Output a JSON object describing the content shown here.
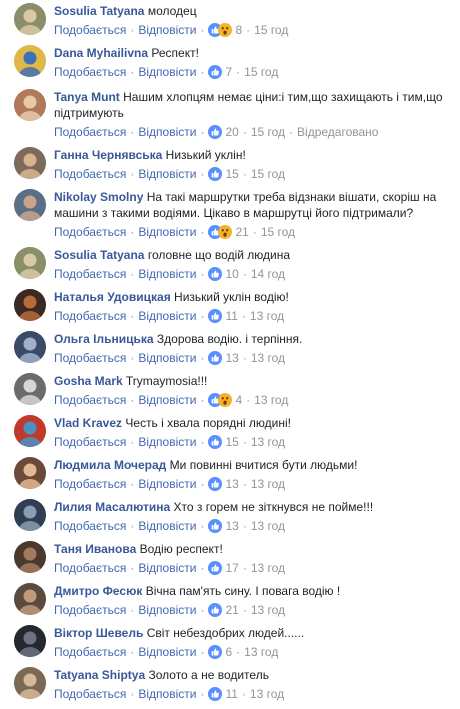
{
  "labels": {
    "like": "Подобається",
    "reply": "Відповісти",
    "edited": "Відредаговано"
  },
  "colors": {
    "link": "#4267b2",
    "author": "#385898",
    "meta": "#90949c",
    "like_blue": "#5890ff",
    "wow_yellow": "#f7b125"
  },
  "comments": [
    {
      "author": "Sosulia Tatyana",
      "text": "молодец",
      "reactions": [
        "like-icon",
        "wow-icon"
      ],
      "count": "8",
      "time": "15 год"
    },
    {
      "author": "Dana Myhailivna",
      "text": "Респект!",
      "reactions": [
        "like-icon"
      ],
      "count": "7",
      "time": "15 год"
    },
    {
      "author": "Tanya Munt",
      "text": "Нашим хлопцям немає ціни:і тим,що захищають і тим,що підтримують",
      "reactions": [
        "like-icon"
      ],
      "count": "20",
      "time": "15 год",
      "edited": true
    },
    {
      "author": "Ганна Чернявська",
      "text": "Низький уклін!",
      "reactions": [
        "like-icon"
      ],
      "count": "15",
      "time": "15 год"
    },
    {
      "author": "Nikolay Smolny",
      "text": "На такі маршрутки треба відзнаки вішати, скоріш на машини з такими водіями. Цікаво в маршрутці його підтримали?",
      "reactions": [
        "like-icon",
        "wow-icon"
      ],
      "count": "21",
      "time": "15 год"
    },
    {
      "author": "Sosulia Tatyana",
      "text": "головне що водій людина",
      "reactions": [
        "like-icon"
      ],
      "count": "10",
      "time": "14 год"
    },
    {
      "author": "Наталья Удовицкая",
      "text": "Низький уклін водію!",
      "reactions": [
        "like-icon"
      ],
      "count": "11",
      "time": "13 год"
    },
    {
      "author": "Ольга Ільницька",
      "text": "Здорова водію. і терпіння.",
      "reactions": [
        "like-icon"
      ],
      "count": "13",
      "time": "13 год"
    },
    {
      "author": "Gosha Mark",
      "text": "Trymaymosia!!!",
      "reactions": [
        "like-icon",
        "wow-icon"
      ],
      "count": "4",
      "time": "13 год"
    },
    {
      "author": "Vlad Kravez",
      "text": "Честь і хвала порядні людині!",
      "reactions": [
        "like-icon"
      ],
      "count": "15",
      "time": "13 год"
    },
    {
      "author": "Людмила Мочерад",
      "text": "Ми повинні вчитися бути людьми!",
      "reactions": [
        "like-icon"
      ],
      "count": "13",
      "time": "13 год"
    },
    {
      "author": "Лилия Масалютина",
      "text": "Хто з горем не зіткнувся не пойме!!!",
      "reactions": [
        "like-icon"
      ],
      "count": "13",
      "time": "13 год"
    },
    {
      "author": "Таня Иванова",
      "text": "Водію респект!",
      "reactions": [
        "like-icon"
      ],
      "count": "17",
      "time": "13 год"
    },
    {
      "author": "Дмитро Фесюк",
      "text": "Вічна пам'ять сину. І повага водію !",
      "reactions": [
        "like-icon"
      ],
      "count": "21",
      "time": "13 год"
    },
    {
      "author": "Віктор Шевель",
      "text": "Світ небездобрих людей......",
      "reactions": [
        "like-icon"
      ],
      "count": "6",
      "time": "13 год"
    },
    {
      "author": "Tatyana Shiptya",
      "text": "Золото а не водитель",
      "reactions": [
        "like-icon"
      ],
      "count": "11",
      "time": "13 год"
    }
  ]
}
